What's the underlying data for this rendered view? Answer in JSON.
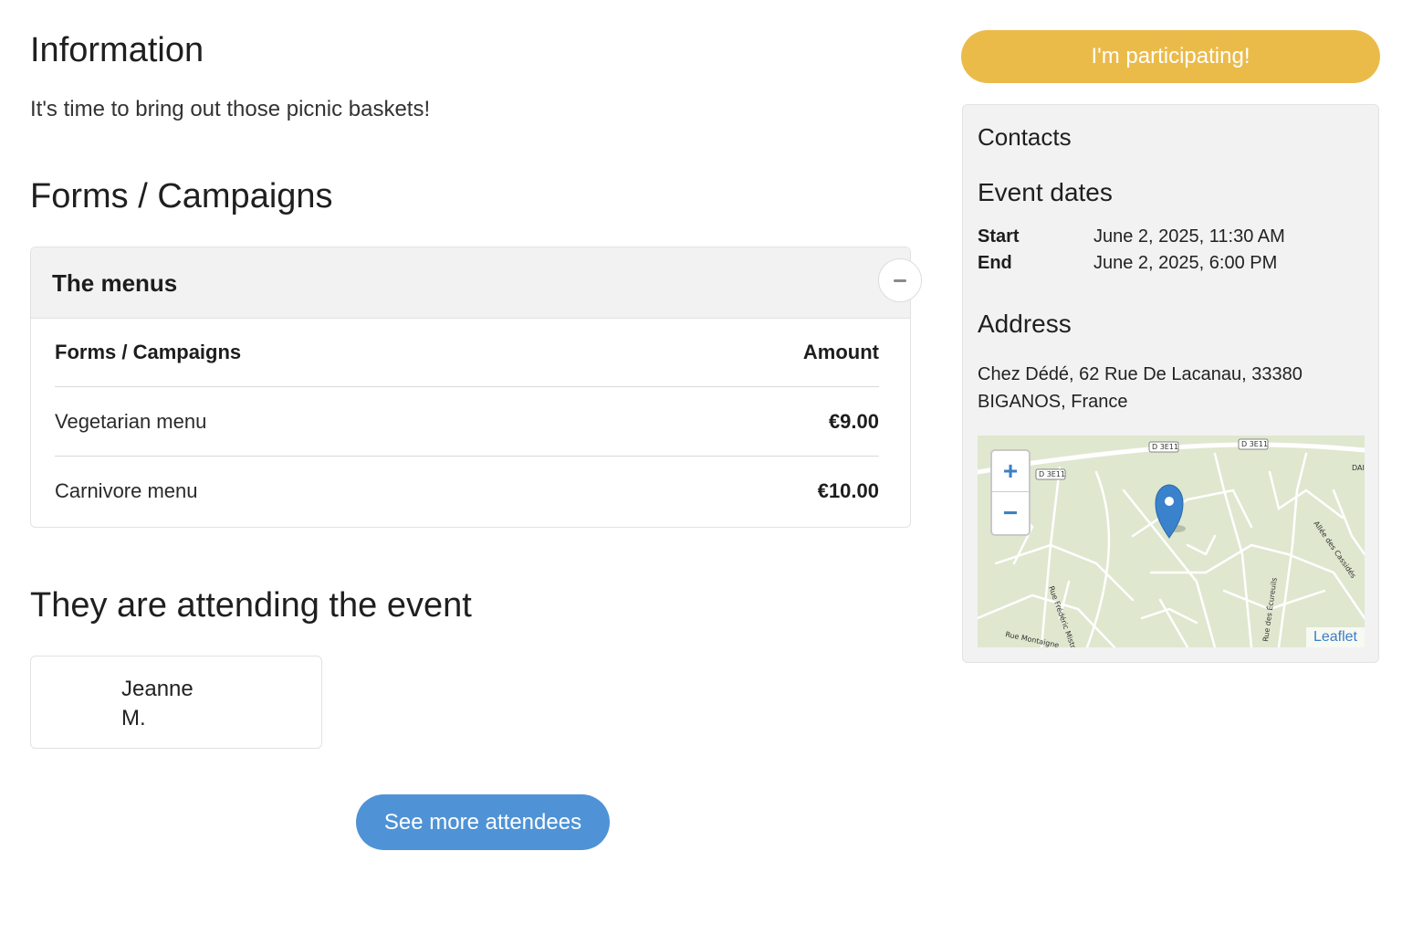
{
  "information": {
    "title": "Information",
    "text": "It's time to bring out those picnic baskets!"
  },
  "forms": {
    "title": "Forms / Campaigns",
    "card_title": "The menus",
    "columns": {
      "name": "Forms / Campaigns",
      "amount": "Amount"
    },
    "rows": [
      {
        "name": "Vegetarian menu",
        "amount": "€9.00"
      },
      {
        "name": "Carnivore menu",
        "amount": "€10.00"
      }
    ]
  },
  "attendees": {
    "title": "They are attending the event",
    "people": [
      {
        "first": "Jeanne",
        "last": "M."
      }
    ],
    "see_more_label": "See more attendees"
  },
  "sidebar": {
    "participate_label": "I'm participating!",
    "contacts_title": "Contacts",
    "dates_title": "Event dates",
    "start_label": "Start",
    "start_value": "June 2, 2025, 11:30 AM",
    "end_label": "End",
    "end_value": "June 2, 2025, 6:00 PM",
    "address_title": "Address",
    "address_text": "Chez Dédé, 62 Rue De Lacanau, 33380 BIGANOS, France",
    "map": {
      "attribution": "Leaflet",
      "road_labels": [
        "D 3E11",
        "D 3E11",
        "D 3E11",
        "DAI",
        "Allée des Cassidés",
        "Rue Frédéric Mistral",
        "Rue Montaigne",
        "Rue des Écureuils"
      ],
      "zoom_in_icon": "plus-icon",
      "zoom_out_icon": "minus-icon",
      "marker_icon": "map-pin-icon"
    }
  },
  "colors": {
    "participate": "#ebbb4a",
    "see_more": "#4f93d6",
    "marker": "#3a82cb"
  }
}
